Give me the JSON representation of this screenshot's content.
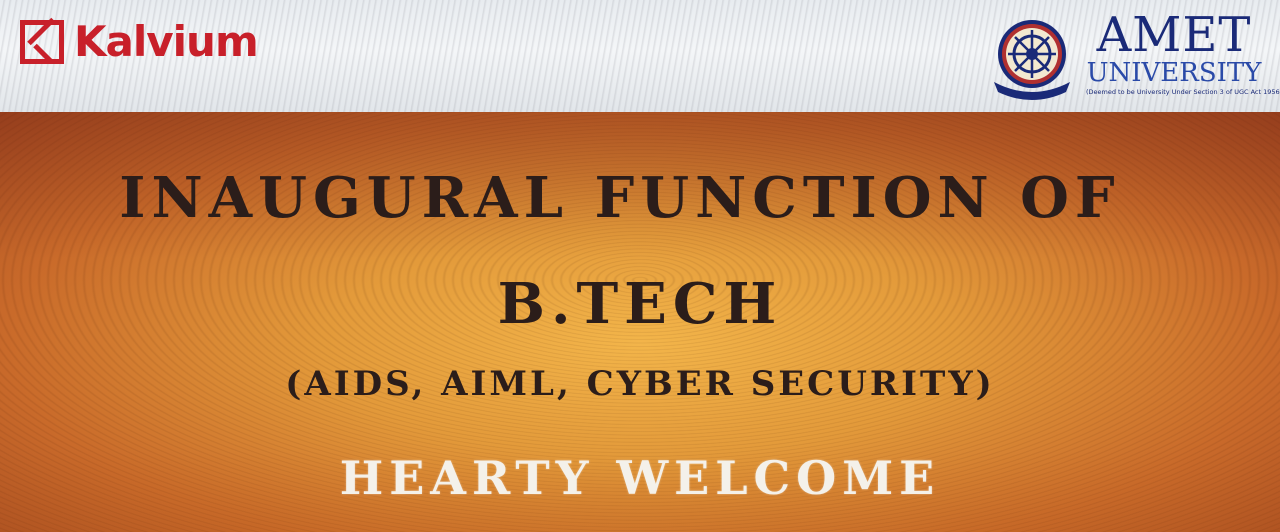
{
  "logos": {
    "left": {
      "name": "Kalvium",
      "color": "#c8202a"
    },
    "right": {
      "title": "AMET",
      "subtitle": "UNIVERSITY",
      "note": "(Deemed to be University Under Section 3 of UGC Act 1956)",
      "color": "#1a2a78"
    }
  },
  "banner": {
    "line1": "INAUGURAL FUNCTION OF",
    "line2": "B.TECH",
    "line3": "(AIDS, AIML, CYBER SECURITY)",
    "line4": "HEARTY WELCOME",
    "accent": "#e39a3a",
    "text_color": "#2b1d1a",
    "welcome_color": "#f4f1ea"
  }
}
